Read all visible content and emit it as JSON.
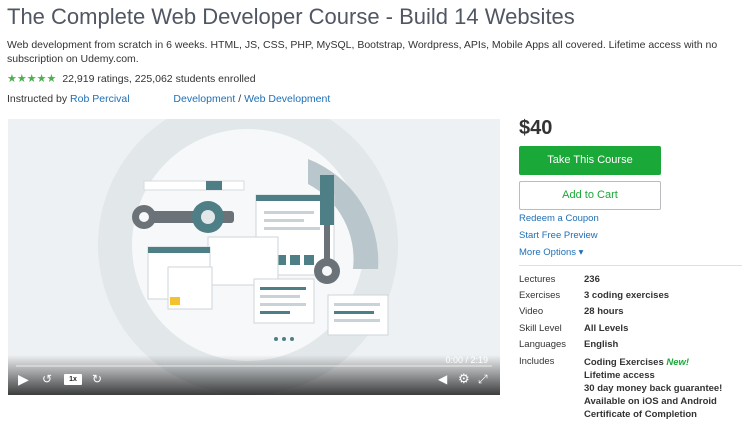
{
  "course": {
    "title": "The Complete Web Developer Course - Build 14 Websites",
    "subtitle": "Web development from scratch in 6 weeks. HTML, JS, CSS, PHP, MySQL, Bootstrap, Wordpress, APIs, Mobile Apps all covered. Lifetime access with no subscription on Udemy.com.",
    "stars": "★★★★★",
    "ratings_text": "22,919 ratings, 225,062 students enrolled",
    "instructed_by": "Instructed by",
    "instructor": "Rob Percival",
    "category": "Development",
    "separator": "/",
    "subcategory": "Web Development"
  },
  "player": {
    "time": "0:00 / 2:19",
    "speed": "1x",
    "rewind_label": "15",
    "forward_label": "15",
    "progress": 0
  },
  "purchase": {
    "price": "$40",
    "take_course": "Take This Course",
    "add_to_cart": "Add to Cart",
    "redeem": "Redeem a Coupon",
    "preview": "Start Free Preview",
    "more_options": "More Options ▾"
  },
  "details": [
    {
      "label": "Lectures",
      "value": "236"
    },
    {
      "label": "Exercises",
      "value": "3 coding exercises"
    },
    {
      "label": "Video",
      "value": "28 hours"
    },
    {
      "label": "Skill Level",
      "value": "All Levels"
    },
    {
      "label": "Languages",
      "value": "English"
    }
  ],
  "includes": {
    "label": "Includes",
    "items": [
      {
        "text": "Coding Exercises",
        "badge": "New!"
      },
      {
        "text": "Lifetime access"
      },
      {
        "text": "30 day money back guarantee!"
      },
      {
        "text": "Available on iOS and Android"
      },
      {
        "text": "Certificate of Completion"
      }
    ]
  },
  "colors": {
    "primary_green": "#1aa838",
    "link_blue": "#1f6fb5",
    "star_green": "#4caf50",
    "illustration_teal": "#4f7f86"
  }
}
